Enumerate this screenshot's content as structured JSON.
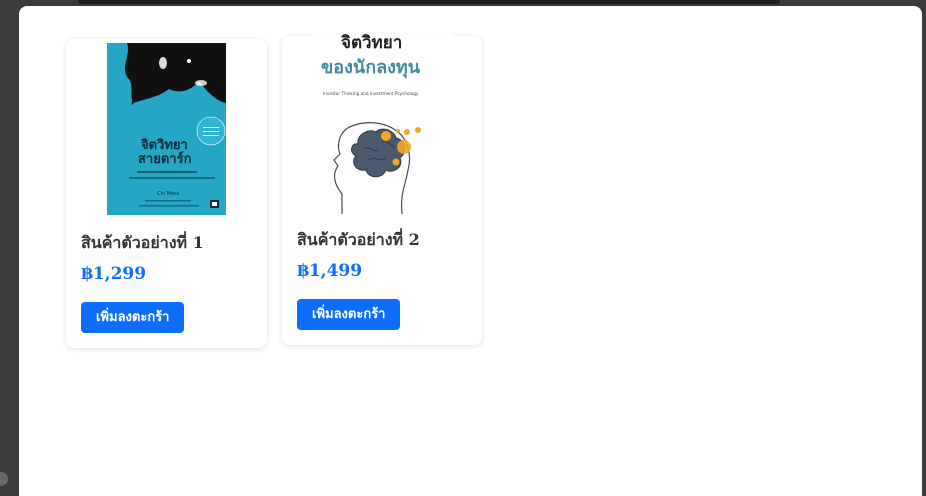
{
  "products": [
    {
      "name": "สินค้าตัวอย่างที่ 1",
      "price": "฿1,299",
      "button_label": "เพิ่มลงตะกร้า",
      "cover": {
        "title_line1": "จิตวิทยา",
        "title_line2": "สายดาร์ก",
        "author": "Chi Mess"
      }
    },
    {
      "name": "สินค้าตัวอย่างที่ 2",
      "price": "฿1,499",
      "button_label": "เพิ่มลงตะกร้า",
      "cover": {
        "title_line1": "จิตวิทยา",
        "title_line2": "ของนักลงทุน",
        "subtitle": "Investor Thinking and Investment Psychology"
      }
    }
  ],
  "colors": {
    "accent": "#0d6efd",
    "cover1_bg": "#25a6c4",
    "cover2_teal": "#3f8d98",
    "brain": "#4a5a6c",
    "orange": "#f5a623"
  }
}
